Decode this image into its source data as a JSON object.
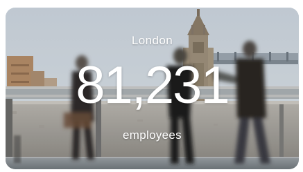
{
  "office_card": {
    "city": "London",
    "employee_count": "81,231",
    "count_label": "employees"
  }
}
